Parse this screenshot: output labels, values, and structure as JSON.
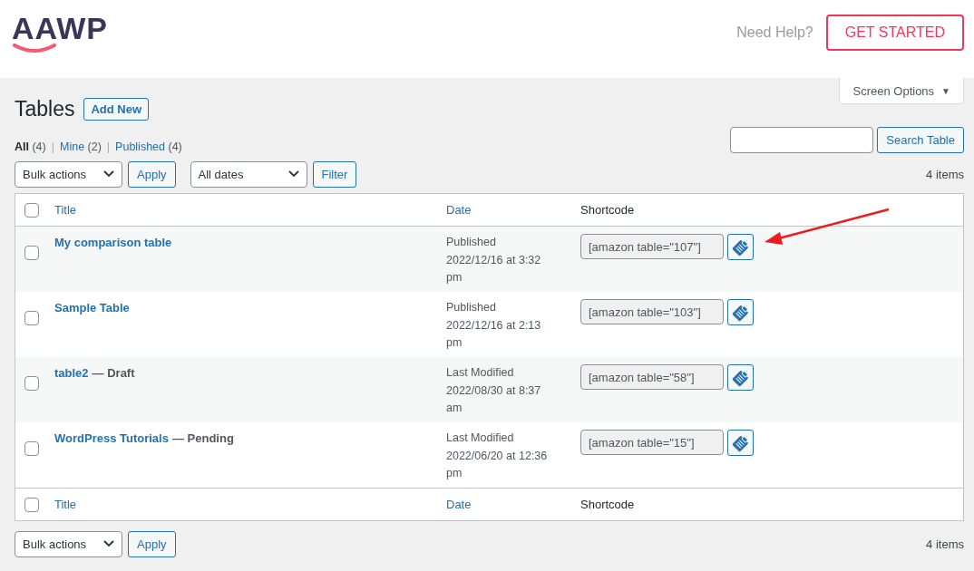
{
  "header": {
    "logo": "AAWP",
    "help_text": "Need Help?",
    "cta_button": "GET STARTED"
  },
  "screen_options": {
    "label": "Screen Options",
    "caret": "▼"
  },
  "page": {
    "title": "Tables",
    "add_new": "Add New"
  },
  "views": [
    {
      "label": "All",
      "count": "(4)",
      "selected": true
    },
    {
      "label": "Mine",
      "count": "(2)",
      "selected": false
    },
    {
      "label": "Published",
      "count": "(4)",
      "selected": false
    }
  ],
  "view_separator": "|",
  "search": {
    "button": "Search Table"
  },
  "top_nav": {
    "bulk_actions": "Bulk actions",
    "apply": "Apply",
    "date_filter": "All dates",
    "filter": "Filter",
    "items_count": "4 items"
  },
  "table": {
    "columns": [
      {
        "label": "Title",
        "sortable": true
      },
      {
        "label": "Date",
        "sortable": true
      },
      {
        "label": "Shortcode",
        "sortable": false
      }
    ],
    "rows": [
      {
        "checked": false,
        "title": "My comparison table",
        "status": "",
        "date_status": "Published",
        "date": "2022/12/16 at 3:32 pm",
        "shortcode": "[amazon table=\"107\"]"
      },
      {
        "checked": false,
        "title": "Sample Table",
        "status": "",
        "date_status": "Published",
        "date": "2022/12/16 at 2:13 pm",
        "shortcode": "[amazon table=\"103\"]"
      },
      {
        "checked": false,
        "title": "table2",
        "status": "— Draft",
        "date_status": "Last Modified",
        "date": "2022/08/30 at 8:37 am",
        "shortcode": "[amazon table=\"58\"]"
      },
      {
        "checked": false,
        "title": "WordPress Tutorials",
        "status": "— Pending",
        "date_status": "Last Modified",
        "date": "2022/06/20 at 12:36 pm",
        "shortcode": "[amazon table=\"15\"]"
      }
    ],
    "footer_columns": [
      {
        "label": "Title",
        "sortable": true
      },
      {
        "label": "Date",
        "sortable": true
      },
      {
        "label": "Shortcode",
        "sortable": false
      }
    ],
    "header_checked": false,
    "footer_checked": false
  },
  "bottom_nav": {
    "bulk_actions": "Bulk actions",
    "apply": "Apply",
    "items_count": "4 items"
  }
}
